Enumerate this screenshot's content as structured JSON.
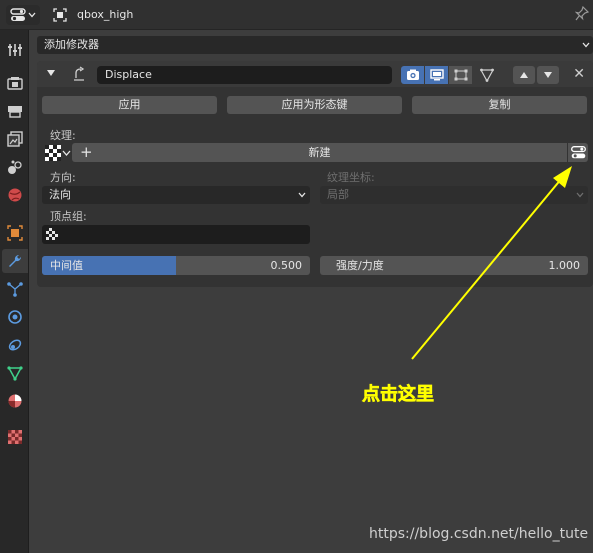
{
  "header": {
    "object_name": "qbox_high"
  },
  "add_modifier": {
    "label": "添加修改器"
  },
  "modifier": {
    "name": "Displace",
    "buttons": {
      "apply": "应用",
      "apply_as_shapekey": "应用为形态键",
      "copy": "复制"
    },
    "texture": {
      "label": "纹理:",
      "new_label": "新建"
    },
    "direction": {
      "label": "方向:",
      "value": "法向"
    },
    "texture_coords": {
      "label": "纹理坐标:",
      "value": "局部"
    },
    "vertex_group": {
      "label": "顶点组:",
      "value": ""
    },
    "midlevel": {
      "label": "中间值",
      "value": "0.500",
      "fraction": 0.5
    },
    "strength": {
      "label": "强度/力度",
      "value": "1.000"
    }
  },
  "annotation": {
    "text": "点击这里",
    "color": "#ffff00"
  },
  "watermark": {
    "text": "https://blog.csdn.net/hello_tute"
  },
  "colors": {
    "accent": "#4772b3",
    "panel_bg": "#333333",
    "window_bg": "#3d3d3d"
  }
}
